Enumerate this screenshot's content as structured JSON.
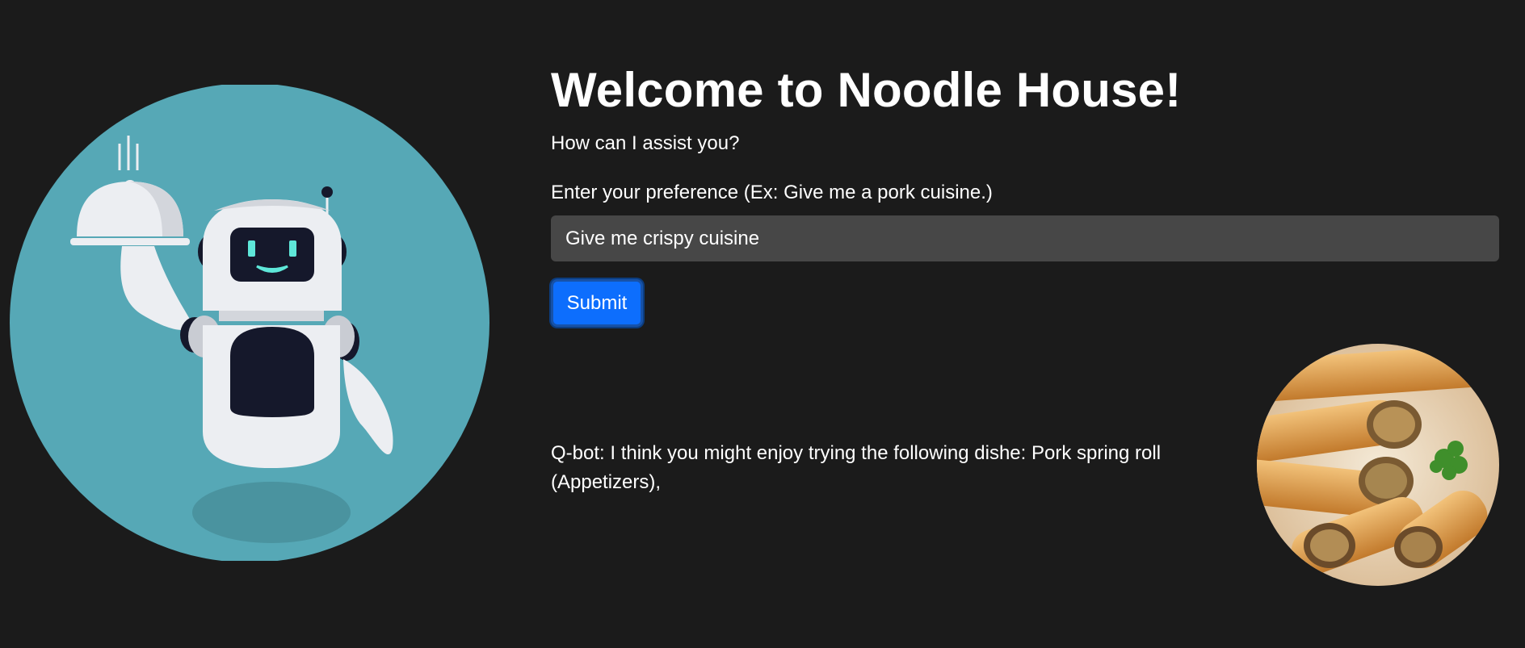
{
  "header": {
    "title": "Welcome to Noodle House!",
    "subtitle": "How can I assist you?"
  },
  "form": {
    "label": "Enter your preference (Ex: Give me a pork cuisine.)",
    "input_value": "Give me crispy cuisine",
    "submit_label": "Submit"
  },
  "response": {
    "text": "Q-bot: I think you might enjoy trying the following dishe: Pork spring roll (Appetizers),"
  },
  "images": {
    "robot": "robot-waiter-illustration",
    "dish": "pork-spring-roll-photo"
  },
  "colors": {
    "background": "#1b1b1b",
    "input_background": "#474747",
    "accent": "#0d6efd",
    "robot_circle": "#56a8b6"
  }
}
